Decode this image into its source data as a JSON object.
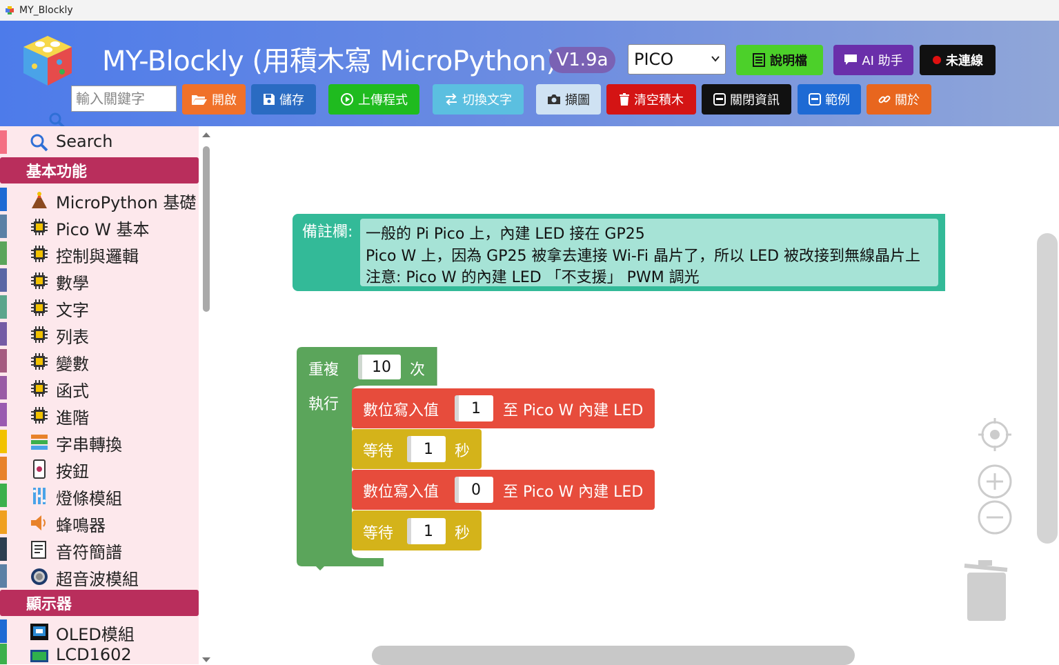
{
  "window": {
    "title": "MY_Blockly"
  },
  "header": {
    "title": "MY-Blockly (用積木寫 MicroPython)",
    "version": "V1.9a",
    "board": "PICO",
    "doc_button": "說明檔",
    "ai_button": "AI 助手",
    "connect_button": "未連線",
    "search_placeholder": "輸入關鍵字"
  },
  "toolbar": {
    "open": "開啟",
    "save": "儲存",
    "upload": "上傳程式",
    "toggle_text": "切換文字",
    "capture": "擷圖",
    "clear": "清空積木",
    "close_info": "關閉資訊",
    "examples": "範例",
    "about": "關於"
  },
  "toolbox": {
    "search": "Search",
    "categories": [
      {
        "label": "基本功能"
      },
      {
        "label": "顯示器"
      }
    ],
    "items": [
      {
        "label": "MicroPython 基礎",
        "color": "#1e6ad4",
        "icon": "volcano-icon"
      },
      {
        "label": "Pico W 基本",
        "color": "#5b80a5",
        "icon": "chip-icon"
      },
      {
        "label": "控制與邏輯",
        "color": "#5ba55b",
        "icon": "chip-icon"
      },
      {
        "label": "數學",
        "color": "#5b67a5",
        "icon": "chip-icon"
      },
      {
        "label": "文字",
        "color": "#5ba58c",
        "icon": "chip-icon"
      },
      {
        "label": "列表",
        "color": "#745ba5",
        "icon": "chip-icon"
      },
      {
        "label": "變數",
        "color": "#a55b80",
        "icon": "chip-icon"
      },
      {
        "label": "函式",
        "color": "#995ba5",
        "icon": "chip-icon"
      },
      {
        "label": "進階",
        "color": "#9a5bb0",
        "icon": "chip-icon"
      },
      {
        "label": "字串轉換",
        "color": "#f2c200",
        "icon": "books-icon"
      },
      {
        "label": "按鈕",
        "color": "#e8822a",
        "icon": "button-icon"
      },
      {
        "label": "燈條模組",
        "color": "#3cb04c",
        "icon": "ledstrip-icon"
      },
      {
        "label": "蜂鳴器",
        "color": "#f0a020",
        "icon": "buzzer-icon"
      },
      {
        "label": "音符簡譜",
        "color": "#2c3e50",
        "icon": "notes-icon"
      },
      {
        "label": "超音波模組",
        "color": "#5b80a5",
        "icon": "sonar-icon"
      },
      {
        "label": "OLED模組",
        "color": "#1e6ad4",
        "icon": "oled-icon"
      },
      {
        "label": "LCD1602",
        "color": "#3cb04c",
        "icon": "lcd-icon"
      }
    ]
  },
  "workspace": {
    "comment": {
      "label": "備註欄:",
      "lines": [
        "一般的 Pi Pico 上，內建 LED 接在 GP25",
        "Pico W 上，因為 GP25 被拿去連接 Wi-Fi 晶片了，所以 LED 被改接到無線晶片上",
        "注意: Pico W 的內建 LED 「不支援」 PWM 調光"
      ]
    },
    "repeat_block": {
      "label": "重複",
      "times": "10",
      "suffix": "次",
      "do": "執行",
      "color": "#5ba55b"
    },
    "statements": [
      {
        "type": "digital_write",
        "label": "數位寫入值",
        "value": "1",
        "target": "至 Pico W 內建 LED",
        "color": "#e74c3c"
      },
      {
        "type": "wait",
        "label": "等待",
        "value": "1",
        "unit": "秒",
        "color": "#d4b31a"
      },
      {
        "type": "digital_write",
        "label": "數位寫入值",
        "value": "0",
        "target": "至 Pico W 內建 LED",
        "color": "#e74c3c"
      },
      {
        "type": "wait",
        "label": "等待",
        "value": "1",
        "unit": "秒",
        "color": "#d4b31a"
      }
    ]
  }
}
